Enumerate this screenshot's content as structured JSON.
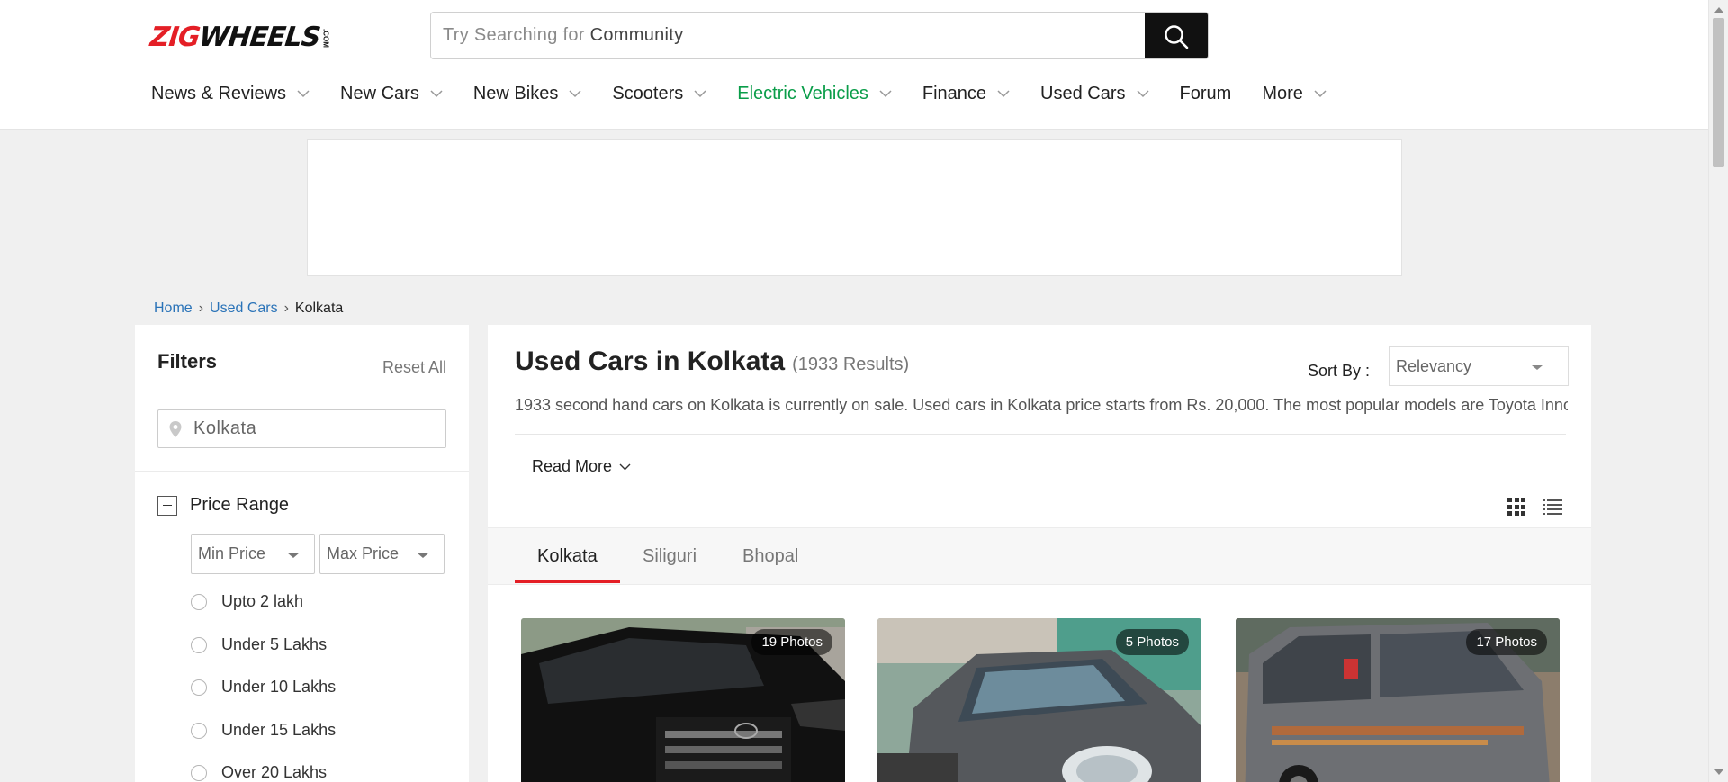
{
  "brand": {
    "logo_red": "ZIG",
    "logo_black": "WHEELS",
    "logo_suffix": ".COM",
    "red": "#e41f26",
    "green": "#0a9d49"
  },
  "search": {
    "prefix": "Try Searching for",
    "suggestion": "Community",
    "icon": "search-icon"
  },
  "nav": [
    {
      "label": "News & Reviews"
    },
    {
      "label": "New Cars"
    },
    {
      "label": "New Bikes"
    },
    {
      "label": "Scooters"
    },
    {
      "label": "Electric Vehicles"
    },
    {
      "label": "Finance"
    },
    {
      "label": "Used Cars"
    },
    {
      "label": "Forum"
    },
    {
      "label": "More"
    }
  ],
  "breadcrumb": {
    "home": "Home",
    "used_cars": "Used Cars",
    "current": "Kolkata",
    "separator": "›"
  },
  "filters": {
    "title": "Filters",
    "reset": "Reset All",
    "location_value": "Kolkata",
    "price_range": {
      "title": "Price Range",
      "min_placeholder": "Min Price",
      "max_placeholder": "Max Price",
      "options": [
        "Upto 2 lakh",
        "Under 5 Lakhs",
        "Under 10 Lakhs",
        "Under 15 Lakhs",
        "Over 20 Lakhs"
      ]
    }
  },
  "results": {
    "title": "Used Cars in Kolkata",
    "count": "(1933 Results)",
    "sort_label": "Sort By :",
    "sort_value": "Relevancy",
    "description": "1933 second hand cars on Kolkata is currently on sale. Used cars in Kolkata price starts from Rs. 20,000. The most popular models are Toyota Innova",
    "read_more": "Read More",
    "tabs": [
      "Kolkata",
      "Siliguri",
      "Bhopal"
    ],
    "cards": [
      {
        "photos": "19 Photos"
      },
      {
        "photos": "5 Photos"
      },
      {
        "photos": "17 Photos"
      }
    ]
  }
}
